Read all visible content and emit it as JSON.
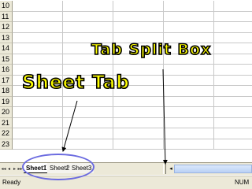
{
  "rows": [
    "10",
    "11",
    "12",
    "13",
    "14",
    "15",
    "16",
    "17",
    "18",
    "19",
    "20",
    "21",
    "22",
    "23"
  ],
  "tab_nav": [
    "◂◂",
    "◂",
    "▸",
    "▸▸"
  ],
  "sheets": [
    {
      "label": "Sheet1",
      "active": true
    },
    {
      "label": "Sheet2",
      "active": false
    },
    {
      "label": "Sheet3",
      "active": false
    }
  ],
  "scroll_left_glyph": "◂",
  "status": {
    "ready": "Ready",
    "num": "NUM"
  },
  "annotations": {
    "tab_split_box": "Tab Split Box",
    "sheet_tab": "Sheet Tab"
  },
  "colors": {
    "annotation_fill": "#ffff00",
    "annotation_outline": "#000000",
    "ellipse": "#6b6be0",
    "chrome": "#ece9d8"
  }
}
